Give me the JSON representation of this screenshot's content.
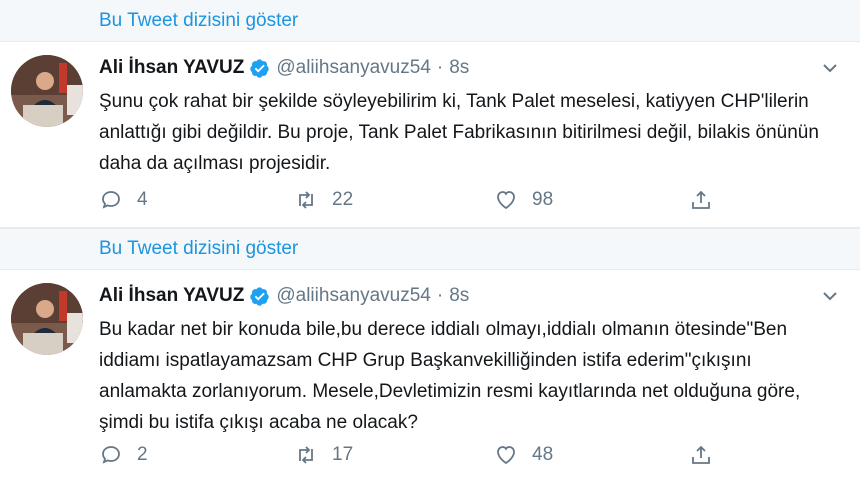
{
  "thread_link_label": "Bu Tweet dizisini göster",
  "colors": {
    "link": "#1b95e0",
    "verified": "#1da1f2",
    "muted": "#657786",
    "divider": "#e6ecf0"
  },
  "tweets": [
    {
      "name": "Ali İhsan YAVUZ",
      "handle": "@aliihsanyavuz54",
      "separator": "·",
      "time": "8s",
      "text": "Şunu çok rahat bir şekilde söyleyebilirim ki, Tank Palet meselesi, katiyyen CHP'lilerin anlattığı gibi değildir. Bu proje, Tank Palet Fabrikasının bitirilmesi değil, bilakis önünün daha da açılması projesidir.",
      "replies": "4",
      "retweets": "22",
      "likes": "98"
    },
    {
      "name": "Ali İhsan YAVUZ",
      "handle": "@aliihsanyavuz54",
      "separator": "·",
      "time": "8s",
      "text": "Bu kadar net bir konuda bile,bu derece iddialı olmayı,iddialı olmanın ötesinde\"Ben iddiamı ispatlayamazsam CHP Grup Başkanvekilliğinden istifa ederim\"çıkışını anlamakta zorlanıyorum. Mesele,Devletimizin resmi kayıtlarında net olduğuna göre, şimdi bu istifa çıkışı acaba ne olacak?",
      "replies": "2",
      "retweets": "17",
      "likes": "48"
    }
  ]
}
